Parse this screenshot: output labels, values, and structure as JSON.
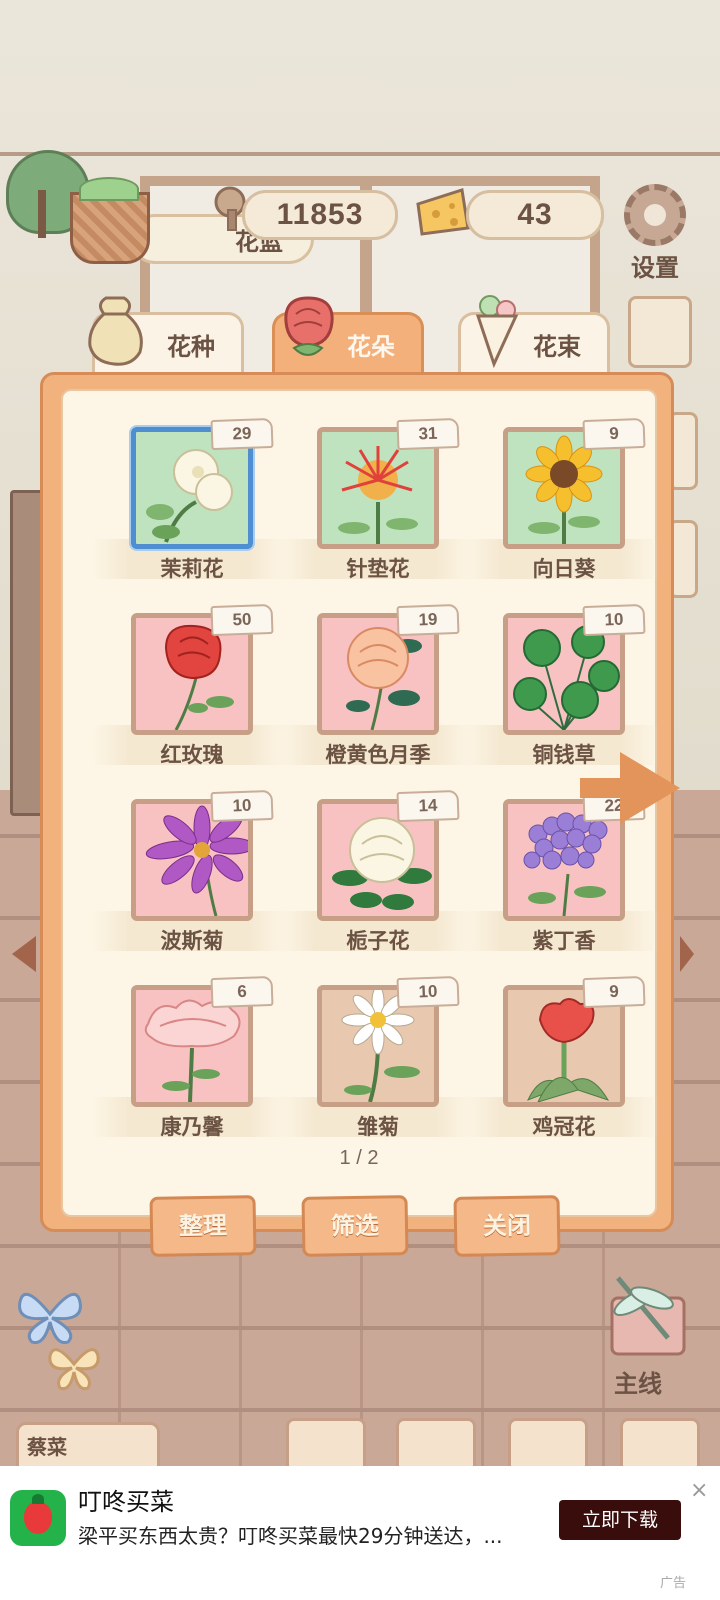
{
  "hud": {
    "coins": "11853",
    "cheese": "43",
    "settings_label": "设置",
    "basket_label": "花篮"
  },
  "tabs": [
    {
      "label": "花种",
      "active": false
    },
    {
      "label": "花朵",
      "active": true
    },
    {
      "label": "花束",
      "active": false
    }
  ],
  "flowers": [
    {
      "name": "茉莉花",
      "count": "29",
      "bg": "#bfe3bf",
      "selected": true,
      "icon": "jasmine"
    },
    {
      "name": "针垫花",
      "count": "31",
      "bg": "#bfe3bf",
      "selected": false,
      "icon": "pincushion"
    },
    {
      "name": "向日葵",
      "count": "9",
      "bg": "#bfe3bf",
      "selected": false,
      "icon": "sunflower"
    },
    {
      "name": "红玫瑰",
      "count": "50",
      "bg": "#f8c2c2",
      "selected": false,
      "icon": "rose"
    },
    {
      "name": "橙黄色月季",
      "count": "19",
      "bg": "#f8c2c2",
      "selected": false,
      "icon": "china-rose"
    },
    {
      "name": "铜钱草",
      "count": "10",
      "bg": "#f8c2c2",
      "selected": false,
      "icon": "pennywort"
    },
    {
      "name": "波斯菊",
      "count": "10",
      "bg": "#f8c2c2",
      "selected": false,
      "icon": "cosmos"
    },
    {
      "name": "栀子花",
      "count": "14",
      "bg": "#f8c2c2",
      "selected": false,
      "icon": "gardenia"
    },
    {
      "name": "紫丁香",
      "count": "22",
      "bg": "#f8c2c2",
      "selected": false,
      "icon": "lilac"
    },
    {
      "name": "康乃馨",
      "count": "6",
      "bg": "#f8c2c2",
      "selected": false,
      "icon": "carnation"
    },
    {
      "name": "雏菊",
      "count": "10",
      "bg": "#e8c8ae",
      "selected": false,
      "icon": "daisy"
    },
    {
      "name": "鸡冠花",
      "count": "9",
      "bg": "#e8c8ae",
      "selected": false,
      "icon": "cockscomb"
    }
  ],
  "pager": "1 / 2",
  "buttons": {
    "arrange": "整理",
    "filter": "筛选",
    "close": "关闭"
  },
  "mainline_label": "主线",
  "dock_left_label": "蔡菜",
  "ad": {
    "title": "叮咚买菜",
    "desc": "梁平买东西太贵？叮咚买菜最快29分钟送达，...",
    "cta": "立即下载",
    "mark": "广告",
    "close": "×"
  },
  "colors": {
    "panel": "#f1b27e",
    "panel_inner": "#fdf6e6",
    "selected_border": "#4f8ed0",
    "ad_cta": "#3a0d0d"
  }
}
